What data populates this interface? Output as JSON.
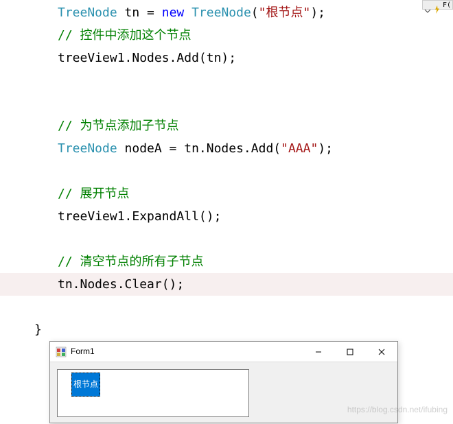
{
  "top_right": {
    "label": "F("
  },
  "code": {
    "l1_t1": "TreeNode",
    "l1_t2": " tn = ",
    "l1_t3": "new",
    "l1_t4": " ",
    "l1_t5": "TreeNode",
    "l1_t6": "(",
    "l1_t7": "\"根节点\"",
    "l1_t8": ");",
    "l2": "// 控件中添加这个节点",
    "l3": "treeView1.Nodes.Add(tn);",
    "l6": "// 为节点添加子节点",
    "l7_t1": "TreeNode",
    "l7_t2": " nodeA = tn.Nodes.Add(",
    "l7_t3": "\"AAA\"",
    "l7_t4": ");",
    "l9": "// 展开节点",
    "l10": "treeView1.ExpandAll();",
    "l12": "// 清空节点的所有子节点",
    "l13": "tn.Nodes.Clear();",
    "brace": "}"
  },
  "form": {
    "title": "Form1",
    "tree_root": "根节点"
  },
  "watermark": "https://blog.csdn.net/ifubing"
}
